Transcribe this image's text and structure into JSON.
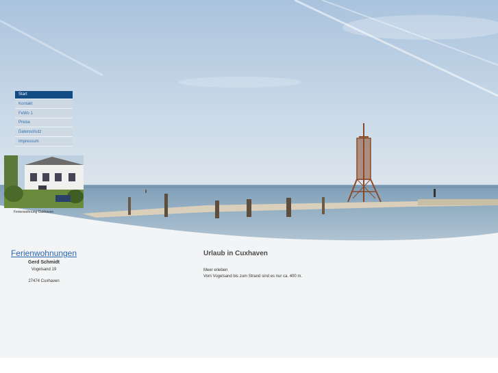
{
  "nav": {
    "items": [
      {
        "label": "Start",
        "active": true
      },
      {
        "label": "Kontakt",
        "active": false
      },
      {
        "label": "FeWo 1",
        "active": false
      },
      {
        "label": "Preise",
        "active": false
      },
      {
        "label": "Datenschutz",
        "active": false
      },
      {
        "label": "Impressum",
        "active": false
      }
    ]
  },
  "photo": {
    "caption": "Ferienwohnung Cuxhaven"
  },
  "address": {
    "heading_link": "Ferienwohnungen",
    "owner": "Gerd Schmidt",
    "street": "Vogelsand 19",
    "city": "27474 Cuxhaven"
  },
  "main": {
    "title": "Urlaub in Cuxhaven",
    "line1": "Meer erleben",
    "line2": "Vom Vogelsand bis zum Strand sind es nur ca. 400 m."
  },
  "colors": {
    "nav_active_bg": "#114b82",
    "nav_bg": "#cfd9e3",
    "link": "#2a66ad",
    "content_bg": "#f3f4f5"
  }
}
